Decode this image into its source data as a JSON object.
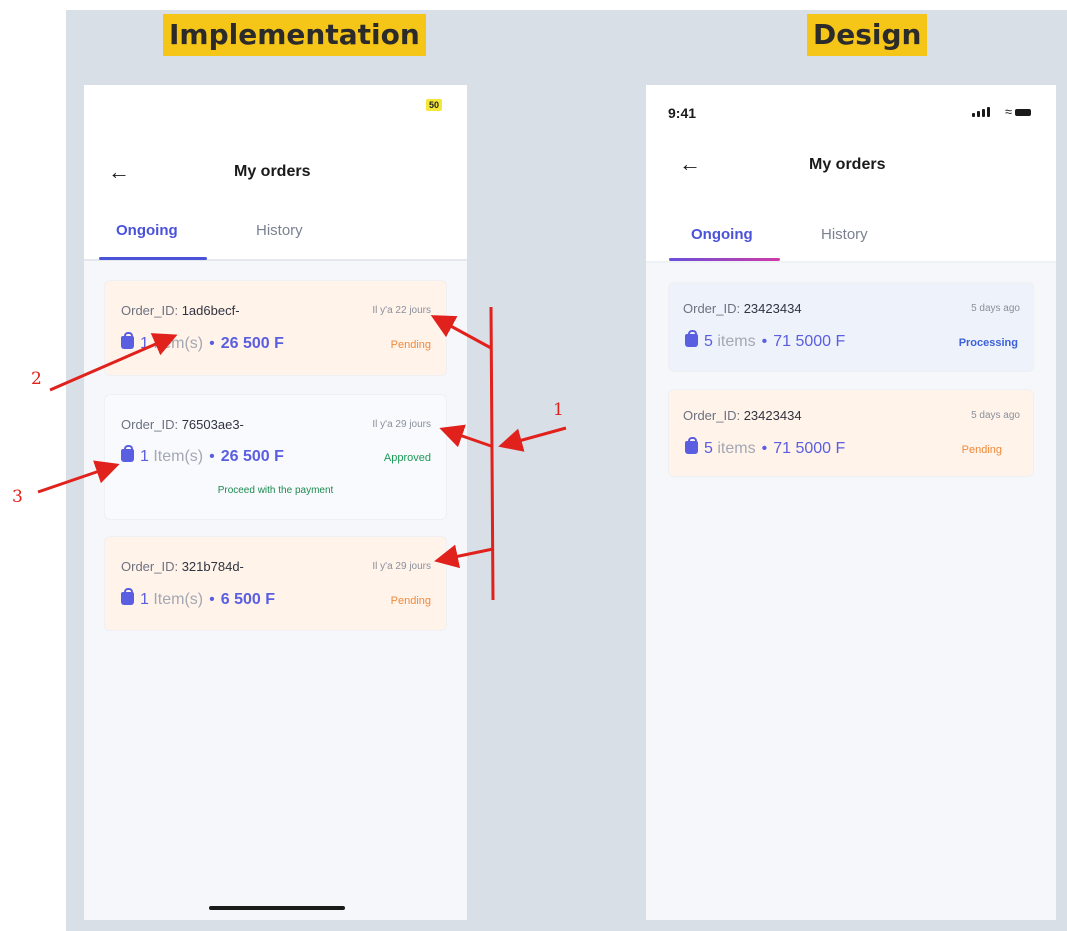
{
  "headings": {
    "implementation": "Implementation",
    "design": "Design"
  },
  "implementation": {
    "status_badge": "50",
    "header": {
      "back_icon": "arrow-left-icon",
      "title": "My orders"
    },
    "tabs": [
      {
        "label": "Ongoing",
        "active": true
      },
      {
        "label": "History",
        "active": false
      }
    ],
    "orders": [
      {
        "order_label": "Order_ID:",
        "order_id": "1ad6becf-",
        "date": "Il y'a 22 jours",
        "quantity": "1",
        "unit": "Item(s)",
        "price": "26 500 F",
        "status": "Pending",
        "status_color": "#f08a3c"
      },
      {
        "order_label": "Order_ID:",
        "order_id": "76503ae3-",
        "date": "Il y'a 29 jours",
        "quantity": "1",
        "unit": "Item(s)",
        "price": "26 500 F",
        "status": "Approved",
        "status_color": "#1d9a56",
        "note": "Proceed with the payment"
      },
      {
        "order_label": "Order_ID:",
        "order_id": "321b784d-",
        "date": "Il y'a 29 jours",
        "quantity": "1",
        "unit": "Item(s)",
        "price": "6 500 F",
        "status": "Pending",
        "status_color": "#f08a3c"
      }
    ]
  },
  "design": {
    "status_bar": {
      "time": "9:41"
    },
    "header": {
      "back_icon": "arrow-left-icon",
      "title": "My orders"
    },
    "tabs": [
      {
        "label": "Ongoing",
        "active": true
      },
      {
        "label": "History",
        "active": false
      }
    ],
    "orders": [
      {
        "order_label": "Order_ID:",
        "order_id": "23423434",
        "date": "5 days ago",
        "quantity": "5",
        "unit": "items",
        "price": "71 5000 F",
        "status": "Processing",
        "status_color": "#3c61d9"
      },
      {
        "order_label": "Order_ID:",
        "order_id": "23423434",
        "date": "5 days ago",
        "quantity": "5",
        "unit": "items",
        "price": "71 5000 F",
        "status": "Pending",
        "status_color": "#f08a3c"
      }
    ]
  },
  "annotations": {
    "one": "1",
    "two": "2",
    "three": "3"
  },
  "colors": {
    "accent": "#4a52d8",
    "annotation": "#e0211c",
    "highlight": "#f5c518"
  }
}
